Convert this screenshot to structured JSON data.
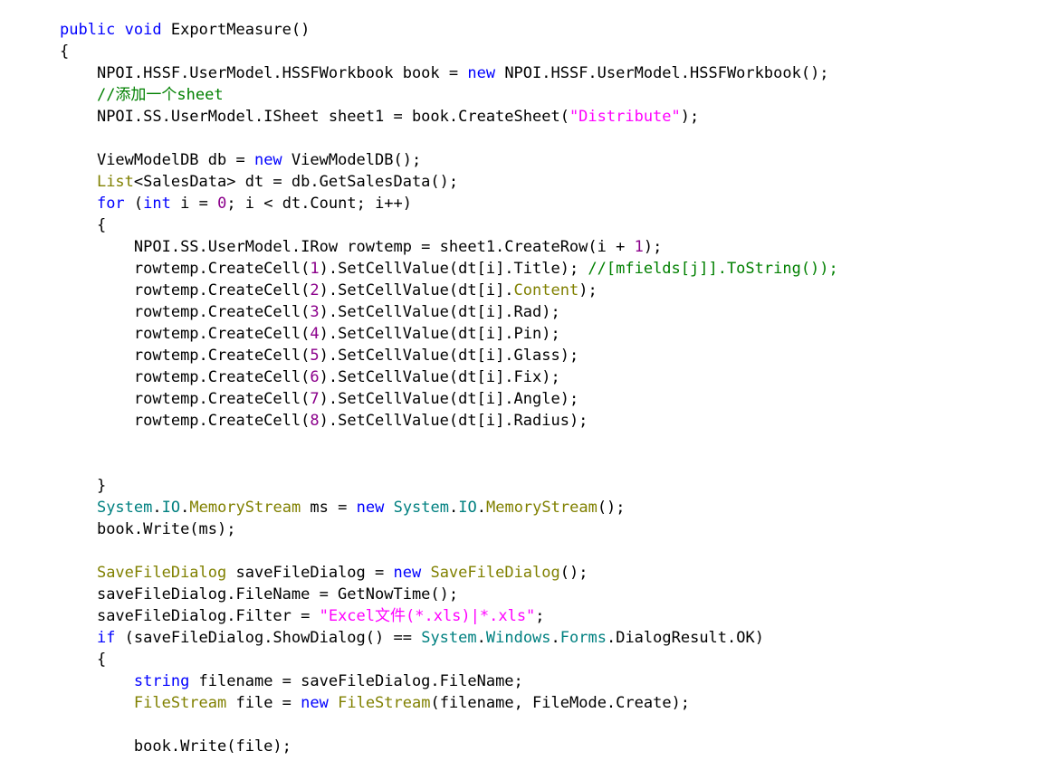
{
  "editor": {
    "language": "C#",
    "background": "#ffffff",
    "default_text_color": "#000000",
    "font_size_px": 17,
    "line_height_px": 24,
    "indent_spaces": 4,
    "palette": {
      "keyword": "#0000ff",
      "type": "#808000",
      "namespace": "#008080",
      "string": "#ff00ff",
      "number": "#8b008b",
      "comment": "#008000",
      "plain": "#000000"
    }
  },
  "code": {
    "lines": [
      {
        "n": 1,
        "indent": 0,
        "tokens": [
          {
            "t": "public",
            "c": "kw"
          },
          {
            "t": " ",
            "c": "pln"
          },
          {
            "t": "void",
            "c": "kw"
          },
          {
            "t": " ExportMeasure()",
            "c": "pln"
          }
        ]
      },
      {
        "n": 2,
        "indent": 0,
        "tokens": [
          {
            "t": "{",
            "c": "pln"
          }
        ]
      },
      {
        "n": 3,
        "indent": 1,
        "tokens": [
          {
            "t": "NPOI.HSSF.UserModel.HSSFWorkbook book = ",
            "c": "pln"
          },
          {
            "t": "new",
            "c": "kw"
          },
          {
            "t": " NPOI.HSSF.UserModel.HSSFWorkbook();",
            "c": "pln"
          }
        ]
      },
      {
        "n": 4,
        "indent": 1,
        "tokens": [
          {
            "t": "//添加一个sheet",
            "c": "cmt"
          }
        ]
      },
      {
        "n": 5,
        "indent": 1,
        "tokens": [
          {
            "t": "NPOI.SS.UserModel.ISheet sheet1 = book.CreateSheet(",
            "c": "pln"
          },
          {
            "t": "\"Distribute\"",
            "c": "str"
          },
          {
            "t": ");",
            "c": "pln"
          }
        ]
      },
      {
        "n": 6,
        "indent": 0,
        "tokens": []
      },
      {
        "n": 7,
        "indent": 1,
        "tokens": [
          {
            "t": "ViewModelDB db = ",
            "c": "pln"
          },
          {
            "t": "new",
            "c": "kw"
          },
          {
            "t": " ViewModelDB();",
            "c": "pln"
          }
        ]
      },
      {
        "n": 8,
        "indent": 1,
        "tokens": [
          {
            "t": "List",
            "c": "type"
          },
          {
            "t": "<SalesData> dt = db.GetSalesData();",
            "c": "pln"
          }
        ]
      },
      {
        "n": 9,
        "indent": 1,
        "tokens": [
          {
            "t": "for",
            "c": "kw"
          },
          {
            "t": " (",
            "c": "pln"
          },
          {
            "t": "int",
            "c": "kw"
          },
          {
            "t": " i = ",
            "c": "pln"
          },
          {
            "t": "0",
            "c": "num"
          },
          {
            "t": "; i < dt.Count; i++)",
            "c": "pln"
          }
        ]
      },
      {
        "n": 10,
        "indent": 1,
        "tokens": [
          {
            "t": "{",
            "c": "pln"
          }
        ]
      },
      {
        "n": 11,
        "indent": 2,
        "tokens": [
          {
            "t": "NPOI.SS.UserModel.IRow rowtemp = sheet1.CreateRow(i + ",
            "c": "pln"
          },
          {
            "t": "1",
            "c": "num"
          },
          {
            "t": ");",
            "c": "pln"
          }
        ]
      },
      {
        "n": 12,
        "indent": 2,
        "tokens": [
          {
            "t": "rowtemp.CreateCell(",
            "c": "pln"
          },
          {
            "t": "1",
            "c": "num"
          },
          {
            "t": ").SetCellValue(dt[i].Title); ",
            "c": "pln"
          },
          {
            "t": "//[mfields[j]].ToString());",
            "c": "cmt"
          }
        ]
      },
      {
        "n": 13,
        "indent": 2,
        "tokens": [
          {
            "t": "rowtemp.CreateCell(",
            "c": "pln"
          },
          {
            "t": "2",
            "c": "num"
          },
          {
            "t": ").SetCellValue(dt[i].",
            "c": "pln"
          },
          {
            "t": "Content",
            "c": "type"
          },
          {
            "t": ");",
            "c": "pln"
          }
        ]
      },
      {
        "n": 14,
        "indent": 2,
        "tokens": [
          {
            "t": "rowtemp.CreateCell(",
            "c": "pln"
          },
          {
            "t": "3",
            "c": "num"
          },
          {
            "t": ").SetCellValue(dt[i].Rad);",
            "c": "pln"
          }
        ]
      },
      {
        "n": 15,
        "indent": 2,
        "tokens": [
          {
            "t": "rowtemp.CreateCell(",
            "c": "pln"
          },
          {
            "t": "4",
            "c": "num"
          },
          {
            "t": ").SetCellValue(dt[i].Pin);",
            "c": "pln"
          }
        ]
      },
      {
        "n": 16,
        "indent": 2,
        "tokens": [
          {
            "t": "rowtemp.CreateCell(",
            "c": "pln"
          },
          {
            "t": "5",
            "c": "num"
          },
          {
            "t": ").SetCellValue(dt[i].Glass);",
            "c": "pln"
          }
        ]
      },
      {
        "n": 17,
        "indent": 2,
        "tokens": [
          {
            "t": "rowtemp.CreateCell(",
            "c": "pln"
          },
          {
            "t": "6",
            "c": "num"
          },
          {
            "t": ").SetCellValue(dt[i].Fix);",
            "c": "pln"
          }
        ]
      },
      {
        "n": 18,
        "indent": 2,
        "tokens": [
          {
            "t": "rowtemp.CreateCell(",
            "c": "pln"
          },
          {
            "t": "7",
            "c": "num"
          },
          {
            "t": ").SetCellValue(dt[i].Angle);",
            "c": "pln"
          }
        ]
      },
      {
        "n": 19,
        "indent": 2,
        "tokens": [
          {
            "t": "rowtemp.CreateCell(",
            "c": "pln"
          },
          {
            "t": "8",
            "c": "num"
          },
          {
            "t": ").SetCellValue(dt[i].Radius);",
            "c": "pln"
          }
        ]
      },
      {
        "n": 20,
        "indent": 0,
        "tokens": []
      },
      {
        "n": 21,
        "indent": 0,
        "tokens": []
      },
      {
        "n": 22,
        "indent": 1,
        "tokens": [
          {
            "t": "}",
            "c": "pln"
          }
        ]
      },
      {
        "n": 23,
        "indent": 1,
        "tokens": [
          {
            "t": "System",
            "c": "ns"
          },
          {
            "t": ".",
            "c": "pln"
          },
          {
            "t": "IO",
            "c": "ns"
          },
          {
            "t": ".",
            "c": "pln"
          },
          {
            "t": "MemoryStream",
            "c": "type"
          },
          {
            "t": " ms = ",
            "c": "pln"
          },
          {
            "t": "new",
            "c": "kw"
          },
          {
            "t": " ",
            "c": "pln"
          },
          {
            "t": "System",
            "c": "ns"
          },
          {
            "t": ".",
            "c": "pln"
          },
          {
            "t": "IO",
            "c": "ns"
          },
          {
            "t": ".",
            "c": "pln"
          },
          {
            "t": "MemoryStream",
            "c": "type"
          },
          {
            "t": "();",
            "c": "pln"
          }
        ]
      },
      {
        "n": 24,
        "indent": 1,
        "tokens": [
          {
            "t": "book.Write(ms);",
            "c": "pln"
          }
        ]
      },
      {
        "n": 25,
        "indent": 0,
        "tokens": []
      },
      {
        "n": 26,
        "indent": 1,
        "tokens": [
          {
            "t": "SaveFileDialog",
            "c": "type"
          },
          {
            "t": " saveFileDialog = ",
            "c": "pln"
          },
          {
            "t": "new",
            "c": "kw"
          },
          {
            "t": " ",
            "c": "pln"
          },
          {
            "t": "SaveFileDialog",
            "c": "type"
          },
          {
            "t": "();",
            "c": "pln"
          }
        ]
      },
      {
        "n": 27,
        "indent": 1,
        "tokens": [
          {
            "t": "saveFileDialog.FileName = GetNowTime();",
            "c": "pln"
          }
        ]
      },
      {
        "n": 28,
        "indent": 1,
        "tokens": [
          {
            "t": "saveFileDialog.Filter = ",
            "c": "pln"
          },
          {
            "t": "\"Excel文件(*.xls)|*.xls\"",
            "c": "str"
          },
          {
            "t": ";",
            "c": "pln"
          }
        ]
      },
      {
        "n": 29,
        "indent": 1,
        "tokens": [
          {
            "t": "if",
            "c": "kw"
          },
          {
            "t": " (saveFileDialog.ShowDialog() == ",
            "c": "pln"
          },
          {
            "t": "System",
            "c": "ns"
          },
          {
            "t": ".",
            "c": "pln"
          },
          {
            "t": "Windows",
            "c": "ns"
          },
          {
            "t": ".",
            "c": "pln"
          },
          {
            "t": "Forms",
            "c": "ns"
          },
          {
            "t": ".DialogResult.OK)",
            "c": "pln"
          }
        ]
      },
      {
        "n": 30,
        "indent": 1,
        "tokens": [
          {
            "t": "{",
            "c": "pln"
          }
        ]
      },
      {
        "n": 31,
        "indent": 2,
        "tokens": [
          {
            "t": "string",
            "c": "kw"
          },
          {
            "t": " filename = saveFileDialog.FileName;",
            "c": "pln"
          }
        ]
      },
      {
        "n": 32,
        "indent": 2,
        "tokens": [
          {
            "t": "FileStream",
            "c": "type"
          },
          {
            "t": " file = ",
            "c": "pln"
          },
          {
            "t": "new",
            "c": "kw"
          },
          {
            "t": " ",
            "c": "pln"
          },
          {
            "t": "FileStream",
            "c": "type"
          },
          {
            "t": "(filename, FileMode.Create);",
            "c": "pln"
          }
        ]
      },
      {
        "n": 33,
        "indent": 0,
        "tokens": []
      },
      {
        "n": 34,
        "indent": 2,
        "tokens": [
          {
            "t": "book.Write(file);",
            "c": "pln"
          }
        ]
      }
    ]
  }
}
